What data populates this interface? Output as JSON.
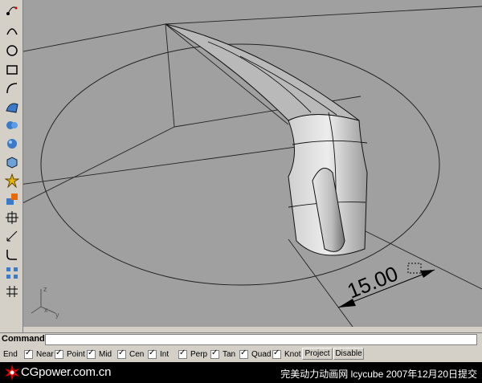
{
  "viewport": {
    "dimension_value": "15.00",
    "axis_labels": {
      "z": "z",
      "x": "x",
      "y": "y"
    }
  },
  "command": {
    "label": "Command:",
    "value": ""
  },
  "osnap": {
    "end_label": "End",
    "items": [
      {
        "label": "Near",
        "checked": true
      },
      {
        "label": "Point",
        "checked": true
      },
      {
        "label": "Mid",
        "checked": true
      },
      {
        "label": "Cen",
        "checked": true
      },
      {
        "label": "Int",
        "checked": true
      },
      {
        "label": "Perp",
        "checked": true
      },
      {
        "label": "Tan",
        "checked": true
      },
      {
        "label": "Quad",
        "checked": true
      },
      {
        "label": "Knot",
        "checked": true
      }
    ],
    "project_label": "Project",
    "disable_label": "Disable"
  },
  "footer": {
    "logo_text": "CGpower.com.cn",
    "credit": "完美动力动画网 lcycube 2007年12月20日提交"
  },
  "toolbar": {
    "icons": [
      "curve-point-icon",
      "arc-icon",
      "circle-icon",
      "rectangle-icon",
      "freeform-curve-icon",
      "surface-icon",
      "solid-icon",
      "sphere-icon",
      "box-icon",
      "explode-icon",
      "boolean-icon",
      "transform-icon",
      "dimension-icon",
      "fillet-icon",
      "array-icon",
      "grid-icon"
    ]
  }
}
